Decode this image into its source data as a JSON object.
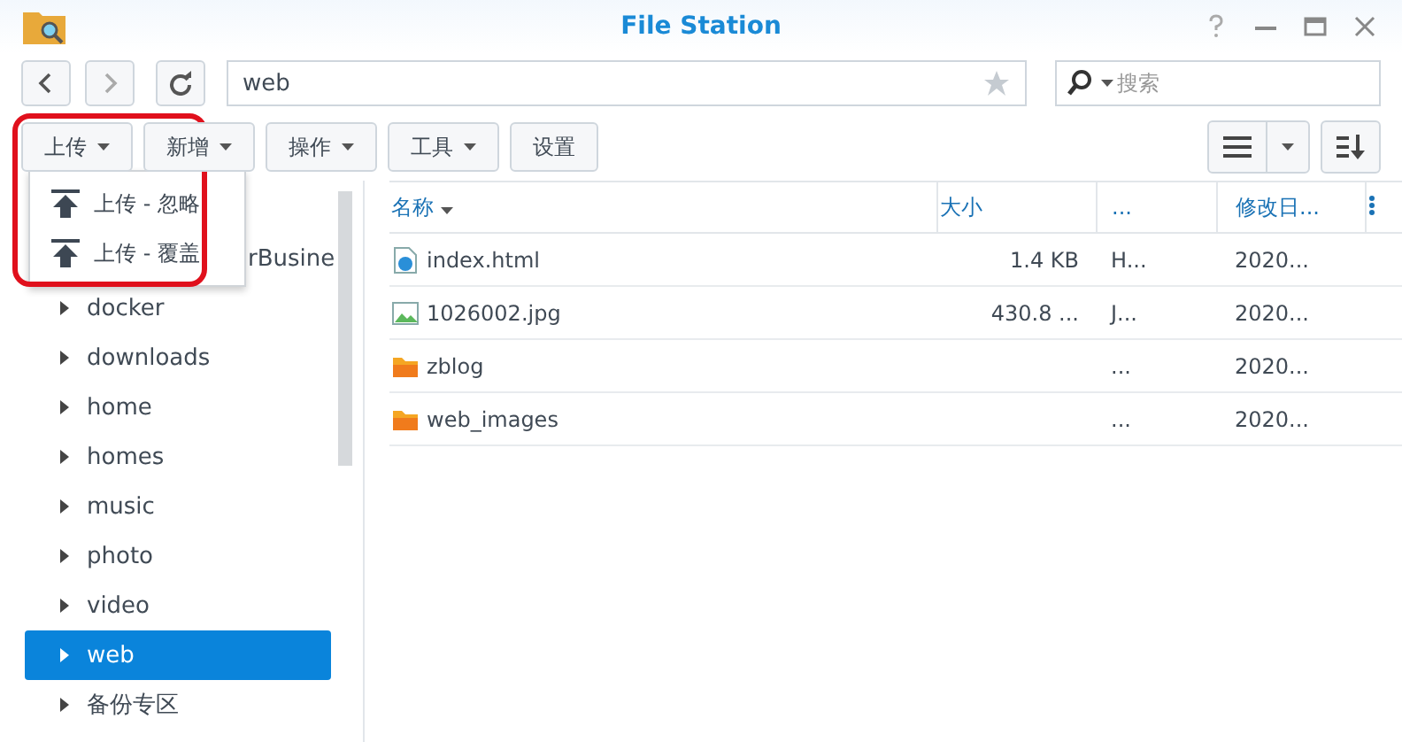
{
  "window": {
    "title": "File Station"
  },
  "address": {
    "value": "web"
  },
  "search": {
    "placeholder": "搜索"
  },
  "toolbar": [
    {
      "label": "上传",
      "dropdown": true
    },
    {
      "label": "新增",
      "dropdown": true
    },
    {
      "label": "操作",
      "dropdown": true
    },
    {
      "label": "工具",
      "dropdown": true
    },
    {
      "label": "设置",
      "dropdown": false
    }
  ],
  "upload_menu": [
    "上传 - 忽略",
    "上传 - 覆盖"
  ],
  "tree": [
    {
      "label": "rBusine",
      "selected": false,
      "partial": true
    },
    {
      "label": "docker",
      "selected": false
    },
    {
      "label": "downloads",
      "selected": false
    },
    {
      "label": "home",
      "selected": false
    },
    {
      "label": "homes",
      "selected": false
    },
    {
      "label": "music",
      "selected": false
    },
    {
      "label": "photo",
      "selected": false
    },
    {
      "label": "video",
      "selected": false
    },
    {
      "label": "web",
      "selected": true
    },
    {
      "label": "备份专区",
      "selected": false
    }
  ],
  "table": {
    "columns": [
      "名称",
      "大小",
      "...",
      "修改日..."
    ],
    "rows": [
      {
        "kind": "html",
        "name": "index.html",
        "size": "1.4 KB",
        "type": "H...",
        "modified": "2020..."
      },
      {
        "kind": "image",
        "name": "1026002.jpg",
        "size": "430.8 ...",
        "type": "J...",
        "modified": "2020..."
      },
      {
        "kind": "folder",
        "name": "zblog",
        "size": "",
        "type": "...",
        "modified": "2020..."
      },
      {
        "kind": "folder",
        "name": "web_images",
        "size": "",
        "type": "...",
        "modified": "2020..."
      }
    ]
  }
}
